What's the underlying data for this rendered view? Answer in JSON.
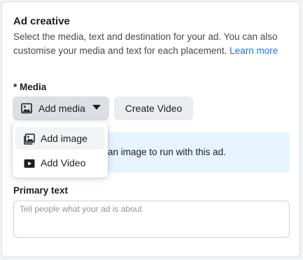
{
  "section": {
    "title": "Ad creative",
    "description": "Select the media, text and destination for your ad. You can also customise your media and text for each placement.",
    "learn_more": "Learn more"
  },
  "media": {
    "label": "* Media",
    "add_media_button": "Add media",
    "create_video_button": "Create Video",
    "info_text": "an image to run with this ad."
  },
  "dropdown": {
    "items": [
      {
        "label": "Add image",
        "icon": "image-icon",
        "highlighted": true
      },
      {
        "label": "Add Video",
        "icon": "video-icon",
        "highlighted": false
      }
    ]
  },
  "primary_text": {
    "label": "Primary text",
    "placeholder": "Tell people what your ad is about",
    "value": ""
  },
  "colors": {
    "link": "#1877f2",
    "info_background": "#e7f3ff",
    "button_background": "#ebedf0"
  }
}
